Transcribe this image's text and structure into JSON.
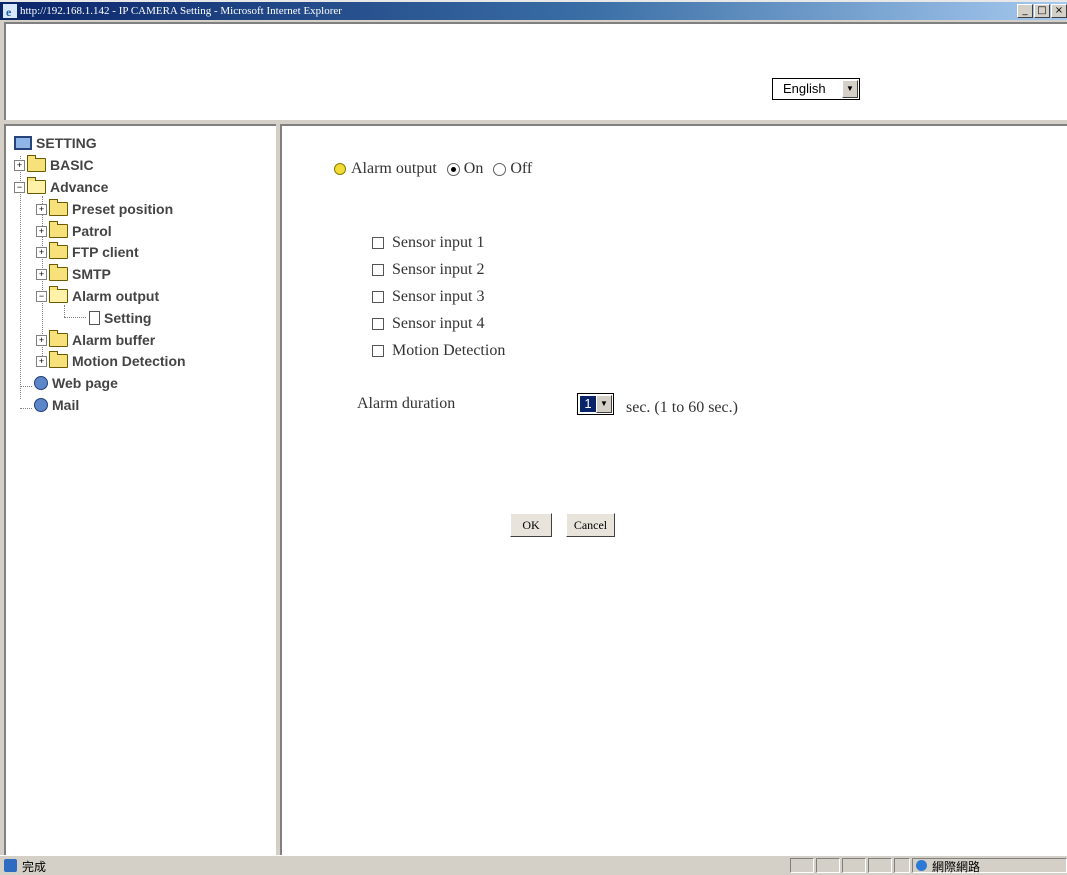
{
  "window": {
    "title": "http://192.168.1.142 - IP CAMERA Setting - Microsoft Internet Explorer",
    "controls": {
      "minimize": "_",
      "maximize": "□",
      "close": "×"
    }
  },
  "header": {
    "language": {
      "selected": "English"
    }
  },
  "sidebar": {
    "root": "SETTING",
    "items": [
      {
        "label": "BASIC"
      },
      {
        "label": "Advance"
      },
      {
        "label": "Preset position"
      },
      {
        "label": "Patrol"
      },
      {
        "label": "FTP client"
      },
      {
        "label": "SMTP"
      },
      {
        "label": "Alarm output"
      },
      {
        "label": "Setting"
      },
      {
        "label": "Alarm buffer"
      },
      {
        "label": "Motion Detection"
      },
      {
        "label": "Web page"
      },
      {
        "label": "Mail"
      }
    ],
    "expand_plus": "+",
    "expand_minus": "−"
  },
  "main": {
    "alarm_output": {
      "label": "Alarm output",
      "on_label": "On",
      "off_label": "Off",
      "selected": "On"
    },
    "triggers": [
      {
        "label": "Sensor input 1",
        "checked": false
      },
      {
        "label": "Sensor input 2",
        "checked": false
      },
      {
        "label": "Sensor input 3",
        "checked": false
      },
      {
        "label": "Sensor input 4",
        "checked": false
      },
      {
        "label": "Motion Detection",
        "checked": false
      }
    ],
    "duration": {
      "label": "Alarm duration",
      "value": "1",
      "unit_text": "sec. (1 to 60 sec.)"
    },
    "ok_label": "OK",
    "cancel_label": "Cancel"
  },
  "statusbar": {
    "text": "完成",
    "zone": "網際網路"
  }
}
